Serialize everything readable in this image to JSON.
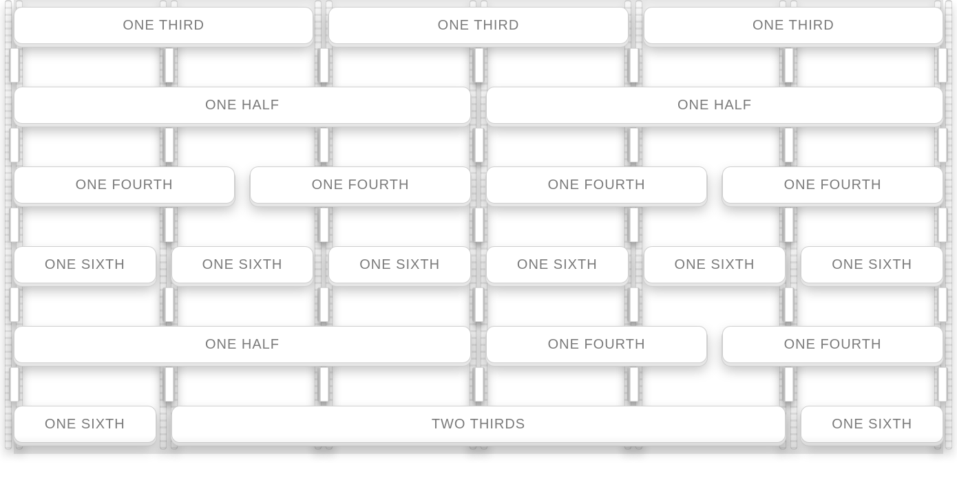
{
  "rows": [
    {
      "cells": [
        {
          "label": "ONE THIRD",
          "w": "w-1-3"
        },
        {
          "label": "ONE THIRD",
          "w": "w-1-3"
        },
        {
          "label": "ONE THIRD",
          "w": "w-1-3"
        }
      ]
    },
    {
      "cells": [
        {
          "label": "ONE HALF",
          "w": "w-1-2"
        },
        {
          "label": "ONE HALF",
          "w": "w-1-2"
        }
      ]
    },
    {
      "cells": [
        {
          "label": "ONE FOURTH",
          "w": "w-1-4"
        },
        {
          "label": "ONE FOURTH",
          "w": "w-1-4"
        },
        {
          "label": "ONE FOURTH",
          "w": "w-1-4"
        },
        {
          "label": "ONE FOURTH",
          "w": "w-1-4"
        }
      ]
    },
    {
      "cells": [
        {
          "label": "ONE SIXTH",
          "w": "w-1-6"
        },
        {
          "label": "ONE SIXTH",
          "w": "w-1-6"
        },
        {
          "label": "ONE SIXTH",
          "w": "w-1-6"
        },
        {
          "label": "ONE SIXTH",
          "w": "w-1-6"
        },
        {
          "label": "ONE SIXTH",
          "w": "w-1-6"
        },
        {
          "label": "ONE SIXTH",
          "w": "w-1-6"
        }
      ]
    },
    {
      "cells": [
        {
          "label": "ONE HALF",
          "w": "w-1-2"
        },
        {
          "label": "ONE FOURTH",
          "w": "w-1-4"
        },
        {
          "label": "ONE FOURTH",
          "w": "w-1-4"
        }
      ]
    },
    {
      "cells": [
        {
          "label": "ONE SIXTH",
          "w": "w-1-6"
        },
        {
          "label": "TWO THIRDS",
          "w": "w-2-3"
        },
        {
          "label": "ONE SIXTH",
          "w": "w-1-6"
        }
      ]
    }
  ],
  "colors": {
    "cellText": "#7a7a7a",
    "cellBorder": "#cfcfcf",
    "shadow": "#e6e6e6"
  }
}
